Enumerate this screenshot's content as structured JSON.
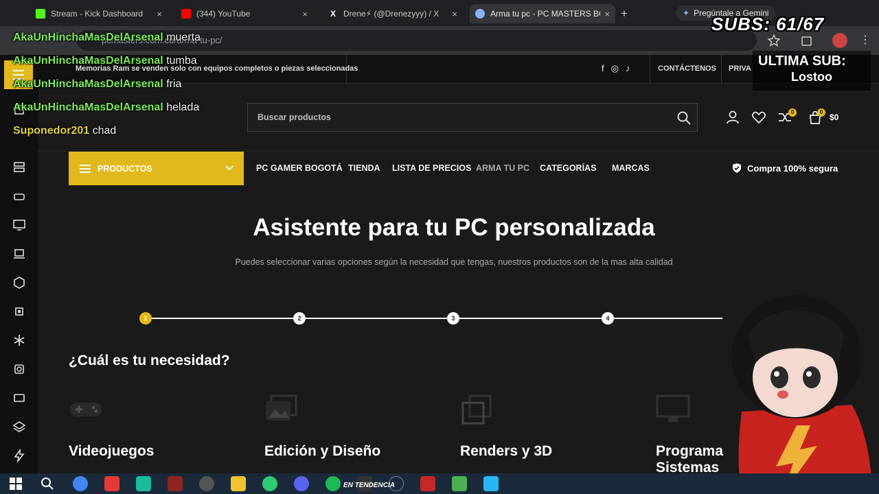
{
  "browser": {
    "tabs": [
      {
        "label": "Stream - Kick Dashboard",
        "close": "×",
        "icon_color": "#53fc18"
      },
      {
        "label": "(344) YouTube",
        "close": "×",
        "icon_color": "#ff0000"
      },
      {
        "label": "Drene⚡ (@Drenezyyy) / X",
        "close": "×",
        "icon_color": "#ffffff"
      },
      {
        "label": "Arma tu pc - PC MASTERS BO",
        "close": "×",
        "icon_color": "#8ab4f8"
      }
    ],
    "new_tab": "+",
    "gemini_label": "Pregúntale a Gemini",
    "url": "pcmasters.com.co/arma-tu-pc/",
    "icons": [
      "star-icon",
      "extension-icon",
      "profile-icon",
      "menu-icon"
    ]
  },
  "site": {
    "promo": "Memorias Ram se venden solo con equipos completos o piezas seleccionadas",
    "contact": "CONTÁCTENOS",
    "privacy": "PRIVA",
    "search_placeholder": "Buscar productos",
    "compare_count": "0",
    "cart_count": "0",
    "cart_total": "$0",
    "nav": {
      "products": "PRODUCTOS",
      "links": [
        "PC GAMER BOGOTÁ",
        "TIENDA",
        "LISTA DE PRECIOS",
        "ARMA TU PC",
        "CATEGORÍAS",
        "MARCAS"
      ],
      "secure": "Compra 100% segura"
    },
    "hero_title": "Asistente para tu PC personalizada",
    "hero_subtitle": "Puedes seleccionar varias opciones según la necesidad que tengas, nuestros productos son de la mas alta calidad",
    "steps": [
      "1",
      "2",
      "3",
      "4"
    ],
    "active_step": 1,
    "need_title": "¿Cuál es tu necesidad?",
    "cards": [
      "Videojuegos",
      "Edición y Diseño",
      "Renders y 3D",
      "Programa Sistemas"
    ]
  },
  "chat": [
    {
      "user": "AkaUnHinchaMasDelArsenal",
      "msg": "muerta"
    },
    {
      "user": "AkaUnHinchaMasDelArsenal",
      "msg": "tumba"
    },
    {
      "user": "AkaUnHinchaMasDelArsenal",
      "msg": "fria"
    },
    {
      "user": "AkaUnHinchaMasDelArsenal",
      "msg": "helada"
    },
    {
      "user": "Suponedor201",
      "msg": "chad"
    }
  ],
  "overlay": {
    "subs": "SUBS: 61/67",
    "last_sub_label": "ULTIMA SUB:",
    "last_sub_name": "Lostoo"
  },
  "taskbar": {
    "trend": "EN TENDENCIA"
  },
  "colors": {
    "accent": "#e2b91c",
    "chat_user": "#7ee85b",
    "bg": "#1a1a1a"
  }
}
